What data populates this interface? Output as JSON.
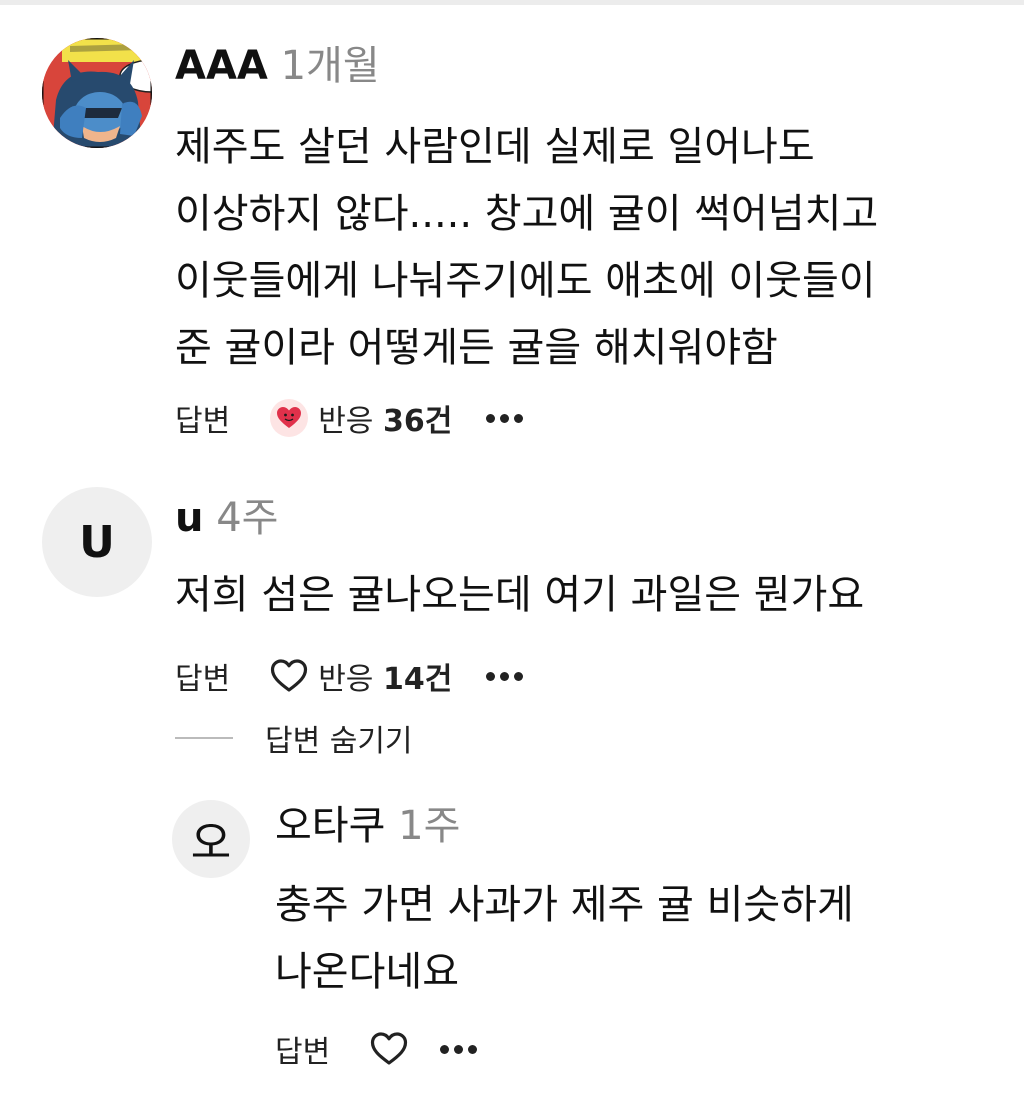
{
  "comments": [
    {
      "author": "AAA",
      "time": "1개월",
      "lines": [
        "제주도 살던 사람인데 실제로 일어나도",
        "이상하지 않다..... 창고에 귤이 썩어넘치고",
        "이웃들에게 나눠주기에도 애초에 이웃들이",
        "준 귤이라 어떻게든 귤을 해치워야함"
      ],
      "reply_label": "답변",
      "reaction_prefix": "반응 ",
      "reaction_count": "36건",
      "avatar_icon": "batman-comic-avatar"
    },
    {
      "author": "u",
      "avatar_letter": "U",
      "time": "4주",
      "lines": [
        "저희 섬은 귤나오는데 여기 과일은 뭔가요"
      ],
      "reply_label": "답변",
      "reaction_prefix": "반응 ",
      "reaction_count": "14건",
      "hide_replies_label": "답변 숨기기"
    },
    {
      "author": "오타쿠",
      "avatar_letter": "오",
      "time": "1주",
      "lines": [
        "충주 가면 사과가 제주 귤 비슷하게",
        "나온다네요"
      ],
      "reply_label": "답변"
    }
  ],
  "colors": {
    "heart_badge_bg": "#fde4e4",
    "heart_red": "#e0314b",
    "meta_gray": "#888888",
    "avatar_bg": "#efefef"
  }
}
